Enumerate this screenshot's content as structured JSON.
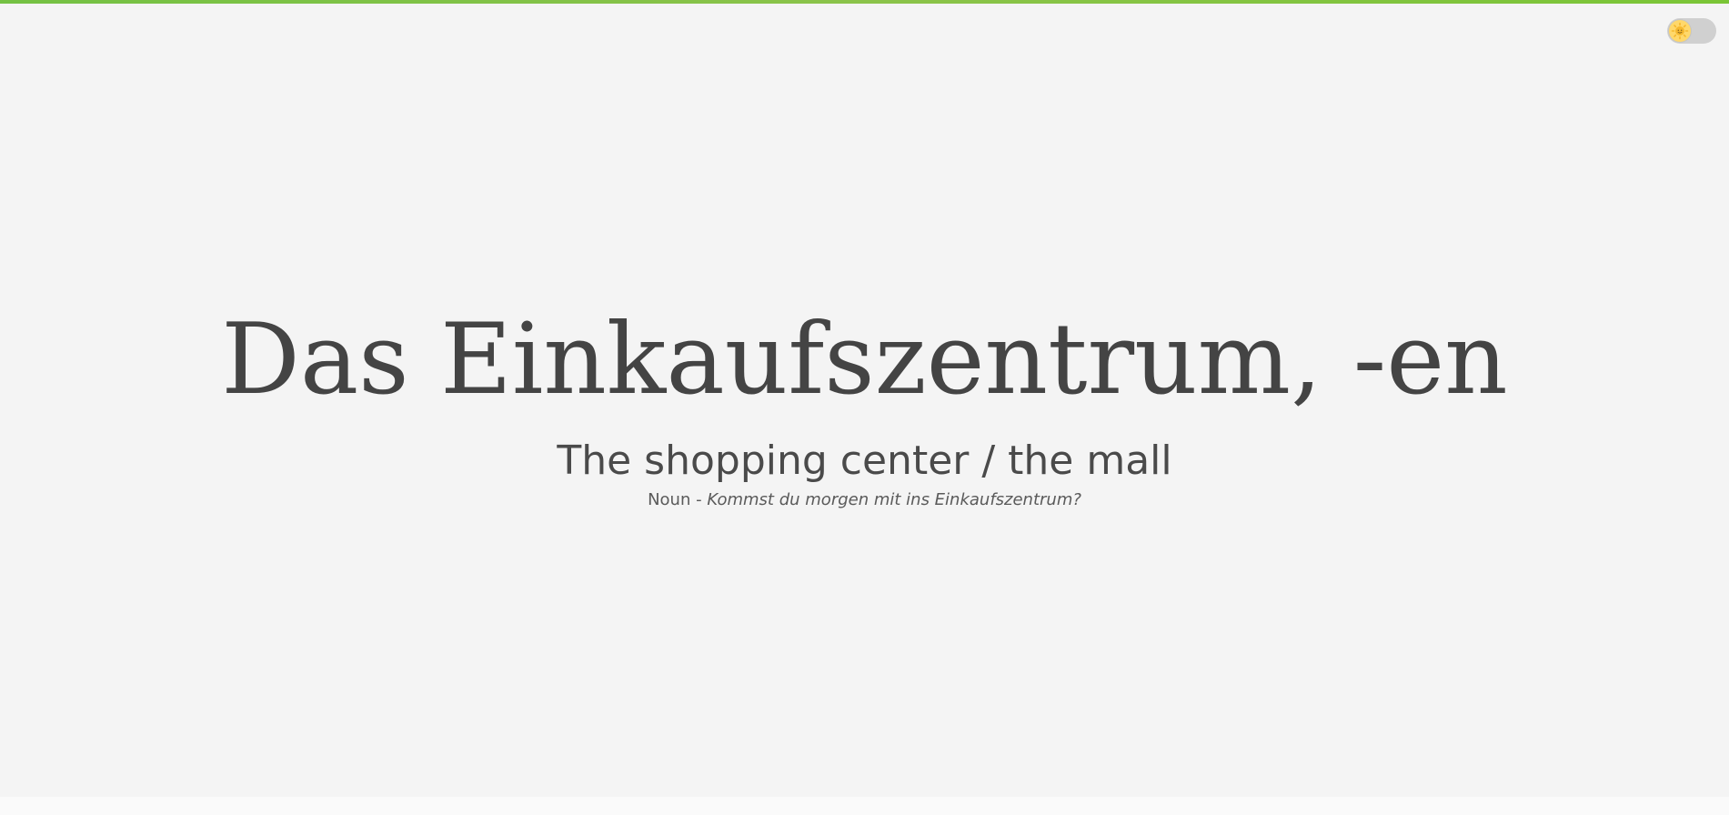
{
  "theme_toggle": {
    "icon": "sun-icon",
    "state": "light"
  },
  "card": {
    "word": "Das Einkaufszentrum, -en",
    "translation": "The shopping center / the mall",
    "part_of_speech": "Noun",
    "separator": " - ",
    "example": "Kommst du morgen mit ins Einkaufszentrum?"
  },
  "colors": {
    "accent": "#7ac536",
    "background": "#f4f4f4",
    "text": "#4a4a4a"
  }
}
